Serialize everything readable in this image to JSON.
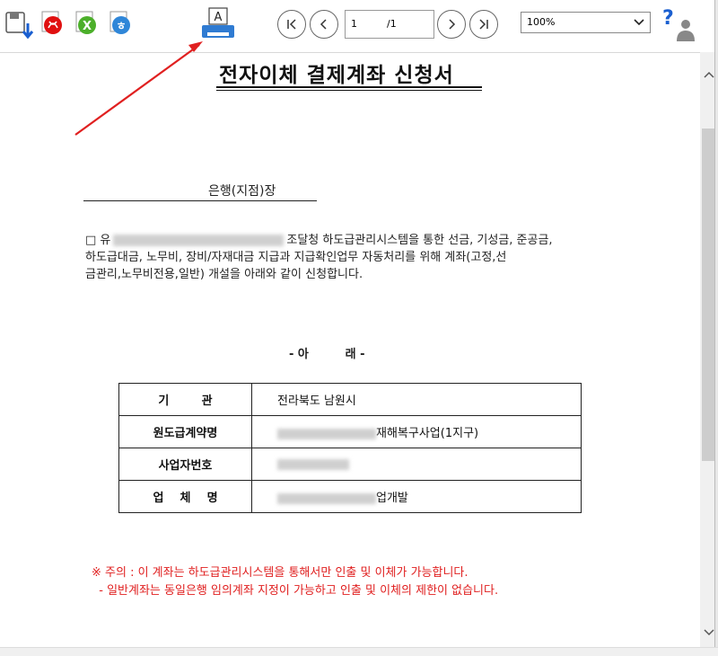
{
  "toolbar": {
    "icons": [
      "save-download-icon",
      "pdf-icon",
      "excel-icon",
      "hwp-icon",
      "print-icon",
      "help-icon"
    ],
    "print_letter": "A",
    "nav": {
      "first": "|<",
      "prev": "<",
      "next": ">",
      "last": ">|"
    },
    "page_current": "1",
    "page_total": "/1",
    "zoom": "100%",
    "help_label": "?"
  },
  "document": {
    "title": "전자이체 결제계좌 신청서",
    "recipient": "은행(지점)장",
    "body_prefix": "□ 유",
    "body_line1_rest": "조달청 하도급관리시스템을 통한 선금, 기성금, 준공금,",
    "body_line2": "하도급대금, 노무비, 장비/자재대금 지급과 지급확인업무 자동처리를 위해 계좌(고정,선",
    "body_line3": "금관리,노무비전용,일반) 개설을 아래와 같이 신청합니다.",
    "ah_label": "- 아         래 -",
    "table": [
      {
        "label": "기        관",
        "value": "전라북도 남원시"
      },
      {
        "label": "원도급계약명",
        "value": "재해복구사업(1지구)"
      },
      {
        "label": "사업자번호",
        "value": ""
      },
      {
        "label": "업    체    명",
        "value": "업개발"
      }
    ],
    "notice_line1": "※ 주의 : 이 계좌는 하도급관리시스템을 통해서만 인출 및 이체가 가능합니다.",
    "notice_line2": "  - 일반계좌는 동일은행 임의계좌 지정이 가능하고 인출 및 이체의 제한이 없습니다."
  },
  "colors": {
    "notice": "#e02020",
    "annotation_arrow": "#e02020"
  }
}
